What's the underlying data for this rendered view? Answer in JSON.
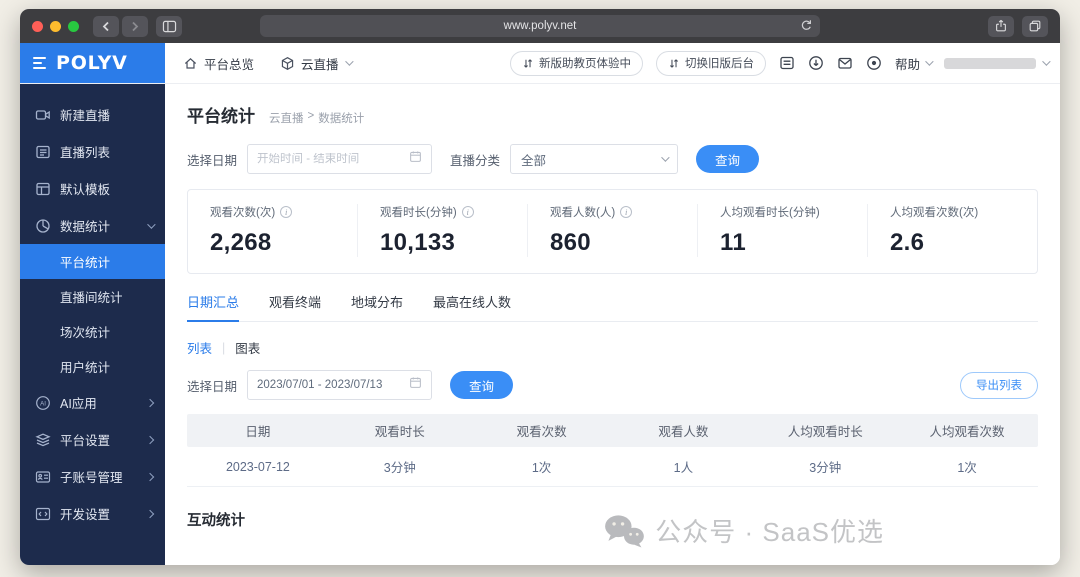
{
  "browser": {
    "url": "www.polyv.net"
  },
  "app_header": {
    "logo": "POLYV",
    "nav_overview": "平台总览",
    "nav_product": "云直播",
    "pill_new_assistant": "新版助教页体验中",
    "pill_switch_old": "切换旧版后台",
    "help": "帮助"
  },
  "sidebar": {
    "items": [
      {
        "label": "新建直播",
        "icon": "video-camera-icon"
      },
      {
        "label": "直播列表",
        "icon": "live-list-icon"
      },
      {
        "label": "默认模板",
        "icon": "template-icon"
      },
      {
        "label": "数据统计",
        "icon": "pie-chart-icon",
        "expanded": true
      }
    ],
    "data_stats_children": [
      {
        "label": "平台统计",
        "active": true
      },
      {
        "label": "直播间统计"
      },
      {
        "label": "场次统计"
      },
      {
        "label": "用户统计"
      }
    ],
    "groups": [
      {
        "label": "AI应用",
        "icon": "ai-icon"
      },
      {
        "label": "平台设置",
        "icon": "layers-icon"
      },
      {
        "label": "子账号管理",
        "icon": "id-card-icon"
      },
      {
        "label": "开发设置",
        "icon": "code-icon"
      }
    ]
  },
  "main": {
    "title": "平台统计",
    "breadcrumb": [
      "云直播",
      "数据统计"
    ],
    "breadcrumb_separator": ">",
    "filters": {
      "date_label": "选择日期",
      "date_placeholder": "开始时间 - 结束时间",
      "category_label": "直播分类",
      "category_value": "全部",
      "query_button": "查询"
    },
    "stats": [
      {
        "label": "观看次数(次)",
        "value": "2,268",
        "info": true
      },
      {
        "label": "观看时长(分钟)",
        "value": "10,133",
        "info": true
      },
      {
        "label": "观看人数(人)",
        "value": "860",
        "info": true
      },
      {
        "label": "人均观看时长(分钟)",
        "value": "11",
        "info": false
      },
      {
        "label": "人均观看次数(次)",
        "value": "2.6",
        "info": false
      }
    ],
    "tabs": [
      {
        "label": "日期汇总",
        "active": true
      },
      {
        "label": "观看终端"
      },
      {
        "label": "地域分布"
      },
      {
        "label": "最高在线人数"
      }
    ],
    "view_toggle": {
      "list": "列表",
      "separator": "|",
      "chart": "图表"
    },
    "table_filter": {
      "date_label": "选择日期",
      "date_value": "2023/07/01 - 2023/07/13",
      "query_button": "查询",
      "export_button": "导出列表"
    },
    "table": {
      "headers": [
        "日期",
        "观看时长",
        "观看次数",
        "观看人数",
        "人均观看时长",
        "人均观看次数"
      ],
      "rows": [
        [
          "2023-07-12",
          "3分钟",
          "1次",
          "1人",
          "3分钟",
          "1次"
        ]
      ]
    },
    "interaction_section_title": "互动统计",
    "watermark": "公众号 · SaaS优选"
  },
  "colors": {
    "accent": "#2b7ce9",
    "sidebar_bg": "#1d2b4c",
    "chrome_bg": "#3d3d40",
    "table_header_bg": "#f0f2f5"
  }
}
